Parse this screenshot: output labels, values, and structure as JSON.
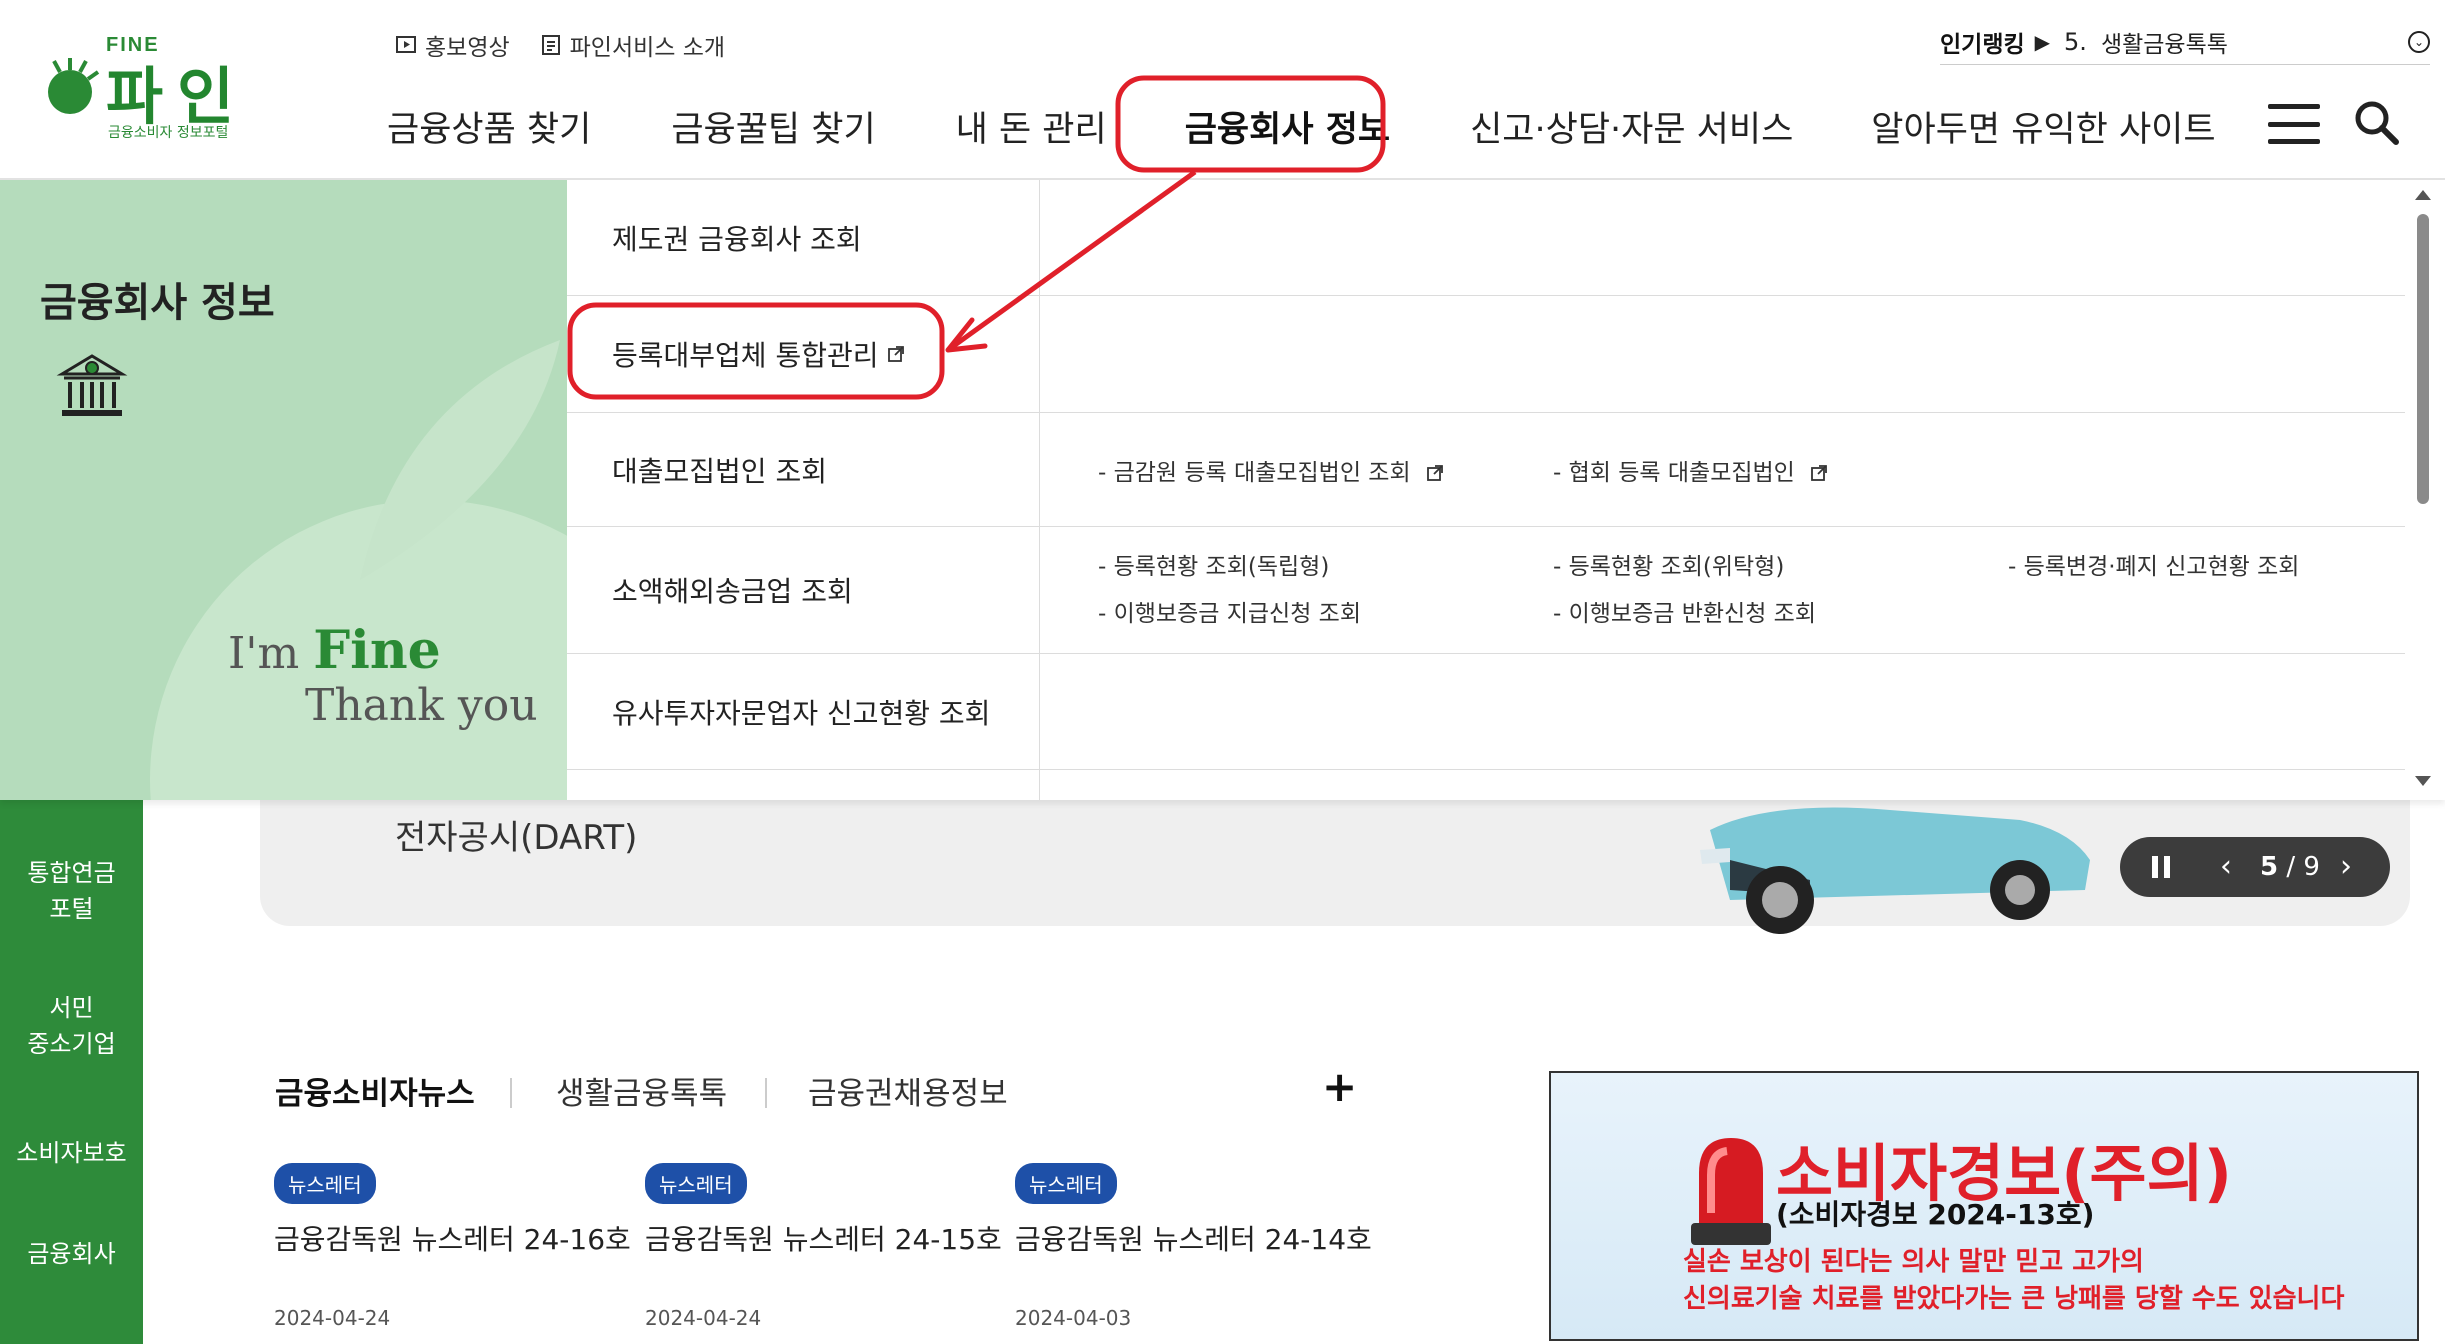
{
  "logo": {
    "fine": "FINE",
    "name": "파인",
    "sub": "금융소비자 정보포털"
  },
  "util_links": [
    {
      "label": "홍보영상",
      "icon": "play-icon"
    },
    {
      "label": "파인서비스 소개",
      "icon": "document-icon"
    }
  ],
  "ranking": {
    "label": "인기랭킹",
    "number": "5.",
    "text": "생활금융톡톡"
  },
  "gnb": [
    "금융상품 찾기",
    "금융꿀팁 찾기",
    "내 돈 관리",
    "금융회사 정보",
    "신고·상담·자문 서비스",
    "알아두면 유익한 사이트"
  ],
  "gnb_active": "금융회사 정보",
  "mega": {
    "title": "금융회사 정보",
    "icon": "bank-icon",
    "slogan": {
      "im": "I'm",
      "fine": "Fine",
      "thanks": "Thank you"
    },
    "rows": [
      {
        "label": "제도권 금융회사 조회",
        "links": []
      },
      {
        "label": "등록대부업체 통합관리",
        "external": true,
        "links": []
      },
      {
        "label": "대출모집법인 조회",
        "links": [
          "- 금감원 등록 대출모집법인 조회",
          "- 협회 등록 대출모집법인"
        ]
      },
      {
        "label": "소액해외송금업 조회",
        "links": [
          "- 등록현황 조회(독립형)",
          "- 등록현황 조회(위탁형)",
          "- 등록변경·폐지 신고현황 조회",
          "- 이행보증금 지급신청 조회",
          "- 이행보증금 반환신청 조회"
        ]
      },
      {
        "label": "유사투자자문업자 신고현황 조회",
        "links": []
      }
    ]
  },
  "left_nav": [
    "통합연금 포털",
    "서민 중소기업",
    "소비자보호",
    "금융회사"
  ],
  "banner": {
    "text": "전자공시(DART)",
    "current": "5",
    "total": "9"
  },
  "news": {
    "tabs": [
      "금융소비자뉴스",
      "생활금융톡톡",
      "금융권채용정보"
    ],
    "items": [
      {
        "badge": "뉴스레터",
        "title": "금융감독원 뉴스레터 24-16호",
        "date": "2024-04-24"
      },
      {
        "badge": "뉴스레터",
        "title": "금융감독원 뉴스레터 24-15호",
        "date": "2024-04-24"
      },
      {
        "badge": "뉴스레터",
        "title": "금융감독원 뉴스레터 24-14호",
        "date": "2024-04-03"
      }
    ]
  },
  "alert": {
    "title": "소비자경보(주의)",
    "sub": "(소비자경보 2024-13호)",
    "line1": "실손 보상이 된다는 의사 말만 믿고 고가의",
    "line2": "신의료기술 치료를 받았다가는 큰 낭패를 당할 수도 있습니다"
  },
  "colors": {
    "brand_green": "#2e8b3a",
    "side_panel": "#b5dcbc",
    "highlight_red": "#e0202a",
    "badge_blue": "#1e50a8"
  }
}
